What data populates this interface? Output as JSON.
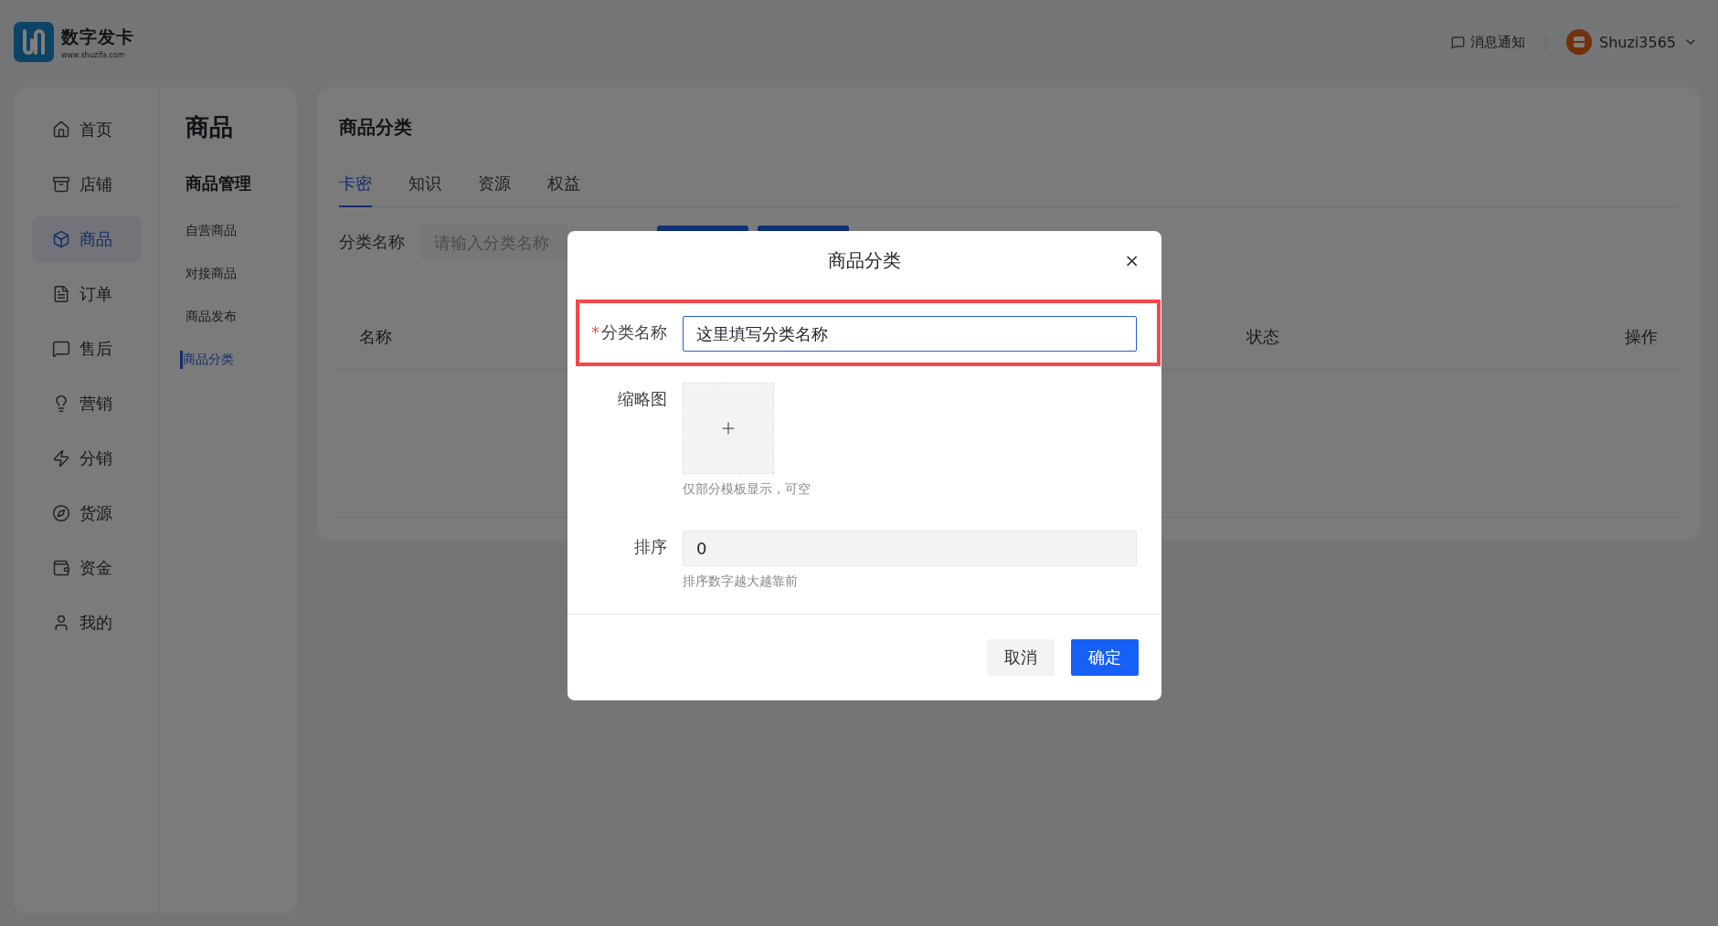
{
  "header": {
    "logo_title": "数字发卡",
    "logo_url": "www.shuzifa.com",
    "notification": "消息通知",
    "user": "Shuzi3565"
  },
  "sidebar": {
    "items": [
      {
        "label": "首页",
        "selected": false
      },
      {
        "label": "店铺",
        "selected": false
      },
      {
        "label": "商品",
        "selected": true
      },
      {
        "label": "订单",
        "selected": false
      },
      {
        "label": "售后",
        "selected": false
      },
      {
        "label": "营销",
        "selected": false
      },
      {
        "label": "分销",
        "selected": false
      },
      {
        "label": "货源",
        "selected": false
      },
      {
        "label": "资金",
        "selected": false
      },
      {
        "label": "我的",
        "selected": false
      }
    ],
    "section_title": "商品",
    "group_title": "商品管理",
    "sub_items": [
      {
        "label": "自营商品",
        "selected": false
      },
      {
        "label": "对接商品",
        "selected": false
      },
      {
        "label": "商品发布",
        "selected": false
      },
      {
        "label": "商品分类",
        "selected": true
      }
    ]
  },
  "main": {
    "title": "商品分类",
    "tabs": [
      {
        "label": "卡密",
        "selected": true
      },
      {
        "label": "知识",
        "selected": false
      },
      {
        "label": "资源",
        "selected": false
      },
      {
        "label": "权益",
        "selected": false
      }
    ],
    "filter": {
      "label": "分类名称",
      "placeholder": "请输入分类名称"
    },
    "table": {
      "columns": [
        "名称",
        "状态",
        "操作"
      ]
    }
  },
  "dialog": {
    "title": "商品分类",
    "close": "×",
    "fields": [
      {
        "kind": "text",
        "label": "分类名称",
        "required_mark": "*",
        "highlighted": true,
        "value": "这里填写分类名称"
      },
      {
        "kind": "upload",
        "label": "缩略图",
        "highlighted": false,
        "hint": "仅部分模板显示，可空"
      },
      {
        "kind": "number",
        "label": "排序",
        "highlighted": false,
        "value": "0",
        "hint": "排序数字越大越靠前"
      }
    ],
    "buttons": [
      {
        "label": "取消",
        "kind": "secondary"
      },
      {
        "label": "确定",
        "kind": "primary"
      }
    ]
  }
}
